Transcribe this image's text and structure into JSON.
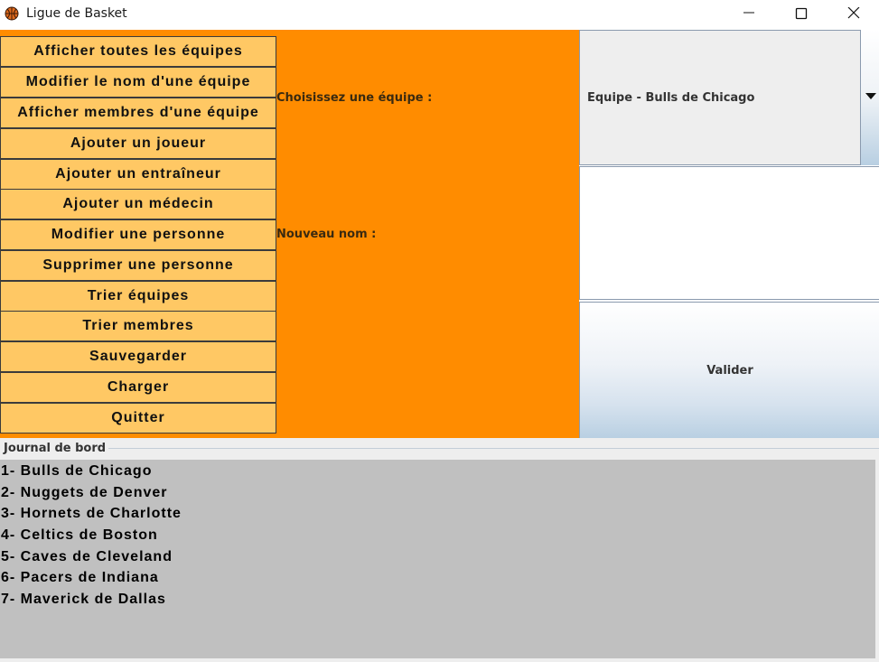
{
  "window": {
    "title": "Ligue de Basket",
    "icon": "basketball-icon"
  },
  "colors": {
    "main_background": "#ff8c00",
    "menu_button": "#ffc864",
    "journal_background": "#c0c0c0",
    "panel_background": "#eeeeee"
  },
  "menu": {
    "items": [
      "Afficher toutes les équipes",
      "Modifier le nom d'une équipe",
      "Afficher membres d'une équipe",
      "Ajouter un joueur",
      "Ajouter un entraîneur",
      "Ajouter un médecin",
      "Modifier une personne",
      "Supprimer une personne",
      "Trier équipes",
      "Trier membres",
      "Sauvegarder",
      "Charger",
      "Quitter"
    ]
  },
  "form": {
    "choose_team_label": "Choisissez une équipe :",
    "team_selected": "Equipe - Bulls de Chicago",
    "new_name_label": "Nouveau nom :",
    "new_name_value": "",
    "validate_label": "Valider"
  },
  "journal": {
    "title": "Journal de bord",
    "lines": [
      "1- Bulls de Chicago",
      "2- Nuggets de Denver",
      "3- Hornets de Charlotte",
      "4- Celtics de Boston",
      "5- Caves de Cleveland",
      "6- Pacers de Indiana",
      "7- Maverick de Dallas"
    ]
  }
}
